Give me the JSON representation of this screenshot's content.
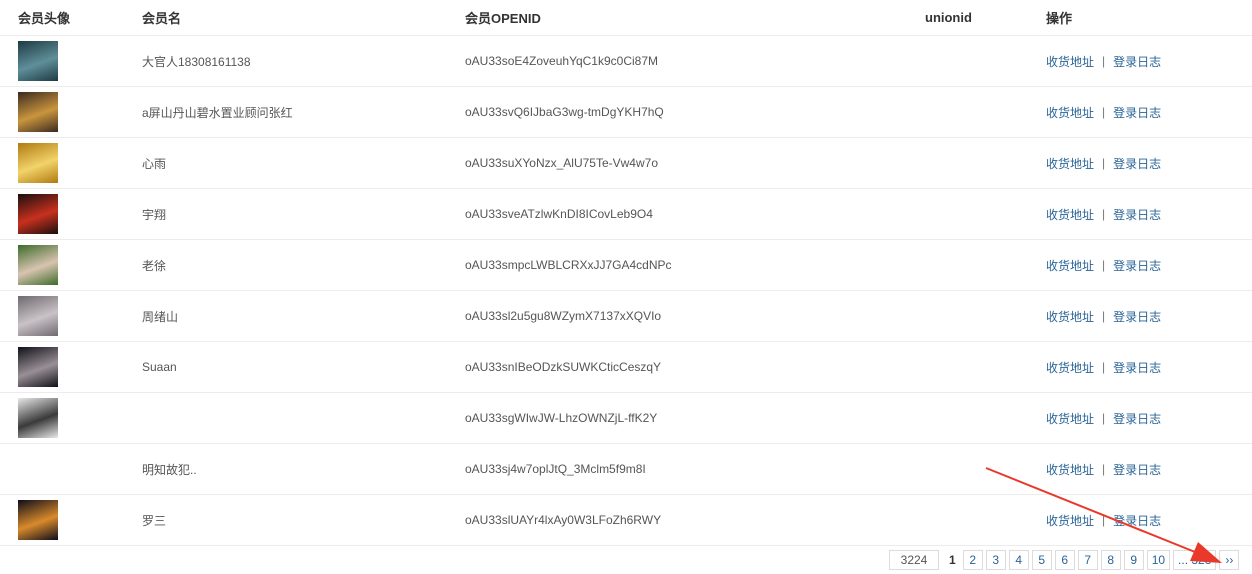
{
  "headers": {
    "avatar": "会员头像",
    "name": "会员名",
    "openid": "会员OPENID",
    "unionid": "unionid",
    "ops": "操作"
  },
  "row_actions": {
    "address": "收货地址",
    "separator": "|",
    "login_log": "登录日志"
  },
  "members": [
    {
      "name": "大官人18308161138",
      "openid": "oAU33soE4ZoveuhYqC1k9c0Ci87M",
      "unionid": "",
      "avatar_colors": [
        "#1e3a44",
        "#5f8f99"
      ]
    },
    {
      "name": "a屏山丹山碧水置业顾问张红",
      "openid": "oAU33svQ6IJbaG3wg-tmDgYKH7hQ",
      "unionid": "",
      "avatar_colors": [
        "#3b2a1f",
        "#c9953e"
      ]
    },
    {
      "name": "心雨",
      "openid": "oAU33suXYoNzx_AlU75Te-Vw4w7o",
      "unionid": "",
      "avatar_colors": [
        "#b07a12",
        "#f2d36a"
      ]
    },
    {
      "name": "宇翔",
      "openid": "oAU33sveATzlwKnDI8ICovLeb9O4",
      "unionid": "",
      "avatar_colors": [
        "#1a0f0f",
        "#c8301e"
      ]
    },
    {
      "name": "老徐",
      "openid": "oAU33smpcLWBLCRXxJJ7GA4cdNPc",
      "unionid": "",
      "avatar_colors": [
        "#3d6b2a",
        "#d8c4b0"
      ]
    },
    {
      "name": "周绪山",
      "openid": "oAU33sl2u5gu8WZymX7137xXQVIo",
      "unionid": "",
      "avatar_colors": [
        "#6f6a70",
        "#c9c2c6"
      ]
    },
    {
      "name": "Suaan",
      "openid": "oAU33snIBeODzkSUWKCticCeszqY",
      "unionid": "",
      "avatar_colors": [
        "#101018",
        "#9a8f96"
      ]
    },
    {
      "name": "",
      "openid": "oAU33sgWIwJW-LhzOWNZjL-ffK2Y",
      "unionid": "",
      "avatar_colors": [
        "#e8e8e8",
        "#3a3a3a"
      ]
    },
    {
      "name": "明知故犯..",
      "openid": "oAU33sj4w7oplJtQ_3Mclm5f9m8I",
      "unionid": "",
      "avatar_colors": null
    },
    {
      "name": "罗三",
      "openid": "oAU33slUAYr4lxAy0W3LFoZh6RWY",
      "unionid": "",
      "avatar_colors": [
        "#0d0d1a",
        "#d98a2b"
      ]
    }
  ],
  "pagination": {
    "total": "3224",
    "current": "1",
    "pages": [
      "2",
      "3",
      "4",
      "5",
      "6",
      "7",
      "8",
      "9",
      "10"
    ],
    "last": "... 323",
    "next": "››"
  },
  "annotation": {
    "arrow_color": "#e8392b",
    "icon": "red-arrow-icon"
  }
}
